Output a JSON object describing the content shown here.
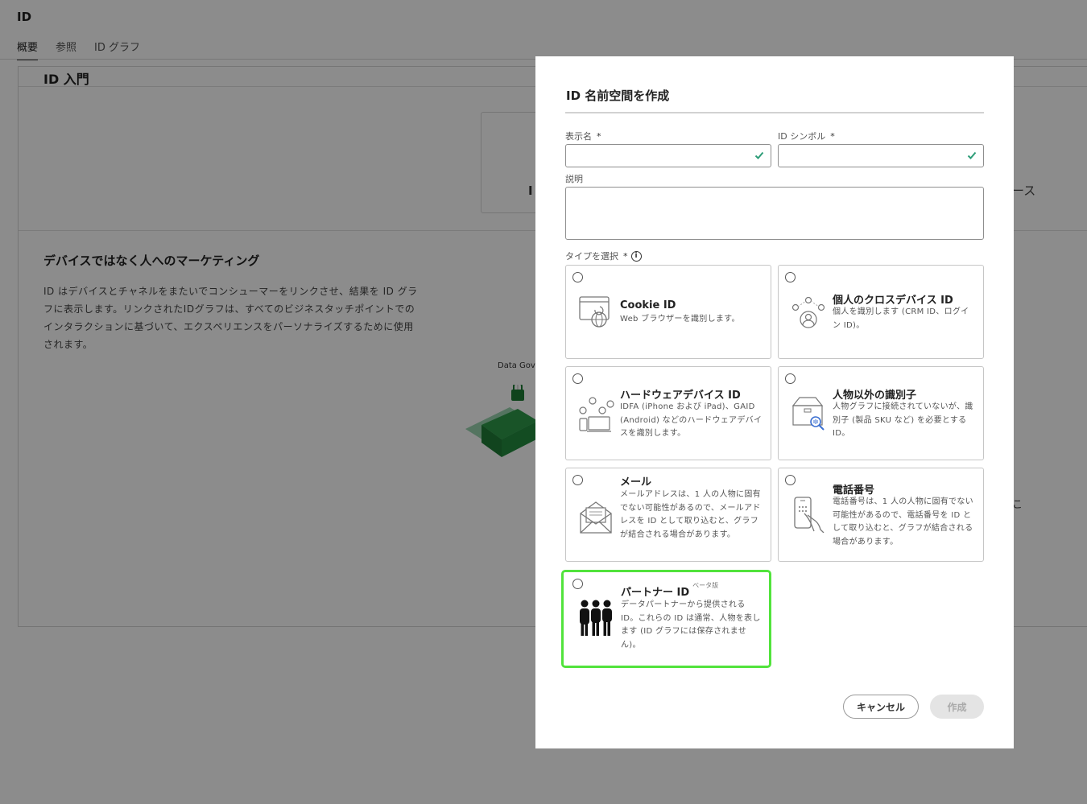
{
  "app": {
    "title": "ID"
  },
  "tabs": [
    {
      "label": "概要",
      "active": true
    },
    {
      "label": "参照",
      "active": false
    },
    {
      "label": "ID グラフ",
      "active": false
    }
  ],
  "background": {
    "card_title": "ID 入門",
    "tile_text": "I",
    "right_snippet": "ース",
    "section_title": "デバイスではなく人へのマーケティング",
    "section_body": "ID はデバイスとチャネルをまたいでコンシューマーをリンクさせ、結果を ID グラフに表示します。リンクされたIDグラフは、すべてのビジネスタッチポイントでのインタラクションに基づいて、エクスペリエンスをパーソナライズするために使用されます。",
    "illustration_label": "Data Gove",
    "right_snippet_2": "こ"
  },
  "modal": {
    "title": "ID 名前空間を作成",
    "display_name_label": "表示名",
    "id_symbol_label": "ID シンボル",
    "required_mark": "*",
    "description_label": "説明",
    "type_label": "タイプを選択",
    "info_glyph": "i",
    "options": [
      {
        "title": "Cookie ID",
        "desc": "Web ブラウザーを識別します。",
        "icon": "cookie-browser-icon"
      },
      {
        "title": "個人のクロスデバイス ID",
        "desc": "個人を識別します (CRM ID、ログイン ID)。",
        "icon": "person-network-icon"
      },
      {
        "title": "ハードウェアデバイス ID",
        "desc": "IDFA (iPhone および iPad)、GAID (Android) などのハードウェアデバイスを識別します。",
        "icon": "hardware-devices-icon"
      },
      {
        "title": "人物以外の識別子",
        "desc": "人物グラフに接続されていないが、識別子 (製品 SKU など) を必要とする ID。",
        "icon": "box-search-icon"
      },
      {
        "title": "メール",
        "desc": "メールアドレスは、1 人の人物に固有でない可能性があるので、メールアドレスを ID として取り込むと、グラフが結合される場合があります。",
        "icon": "envelope-icon"
      },
      {
        "title": "電話番号",
        "desc": "電話番号は、1 人の人物に固有でない可能性があるので、電話番号を ID として取り込むと、グラフが結合される場合があります。",
        "icon": "phone-hand-icon"
      },
      {
        "title": "パートナー ID",
        "badge": "ベータ版",
        "desc": "データパートナーから提供される ID。これらの ID は通常、人物を表します (ID グラフには保存されません)。",
        "icon": "people-group-icon",
        "selected": true
      }
    ],
    "cancel_label": "キャンセル",
    "create_label": "作成"
  },
  "colors": {
    "check": "#2d9d78",
    "highlight": "#52e33c",
    "overlay": "rgba(0,0,0,0.45)"
  }
}
